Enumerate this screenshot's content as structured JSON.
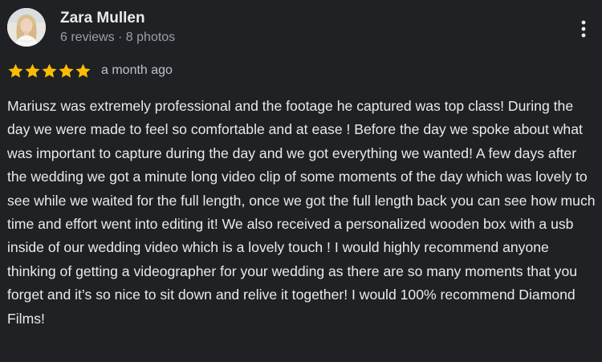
{
  "reviewer": {
    "name": "Zara Mullen",
    "stats": "6 reviews · 8 photos",
    "avatar_icon": "user-avatar-photo"
  },
  "menu": {
    "icon": "more-vert-icon"
  },
  "rating": {
    "stars": 5,
    "max_stars": 5,
    "star_icon": "star-icon",
    "star_color": "#fbbc04",
    "time": "a month ago"
  },
  "review": {
    "text": "Mariusz was extremely professional and the footage he captured was top class! During the day we were made to feel so comfortable and at ease ! Before the day we spoke about what was important to capture during the day and we got everything we wanted! A few days after the wedding we got a minute long video clip of some moments of the day which was lovely to see while we waited for the full length, once we got the full length back you can see how much time and effort went into editing it! We also received a personalized wooden box with a usb inside of our wedding video which is a lovely touch ! I would highly recommend anyone thinking of getting a videographer for your wedding as there are so many moments that you forget and it’s so nice to sit down and relive it together! I would 100% recommend Diamond Films!"
  },
  "colors": {
    "background": "#202124",
    "primary_text": "#e8eaed",
    "secondary_text": "#9aa0a6"
  }
}
